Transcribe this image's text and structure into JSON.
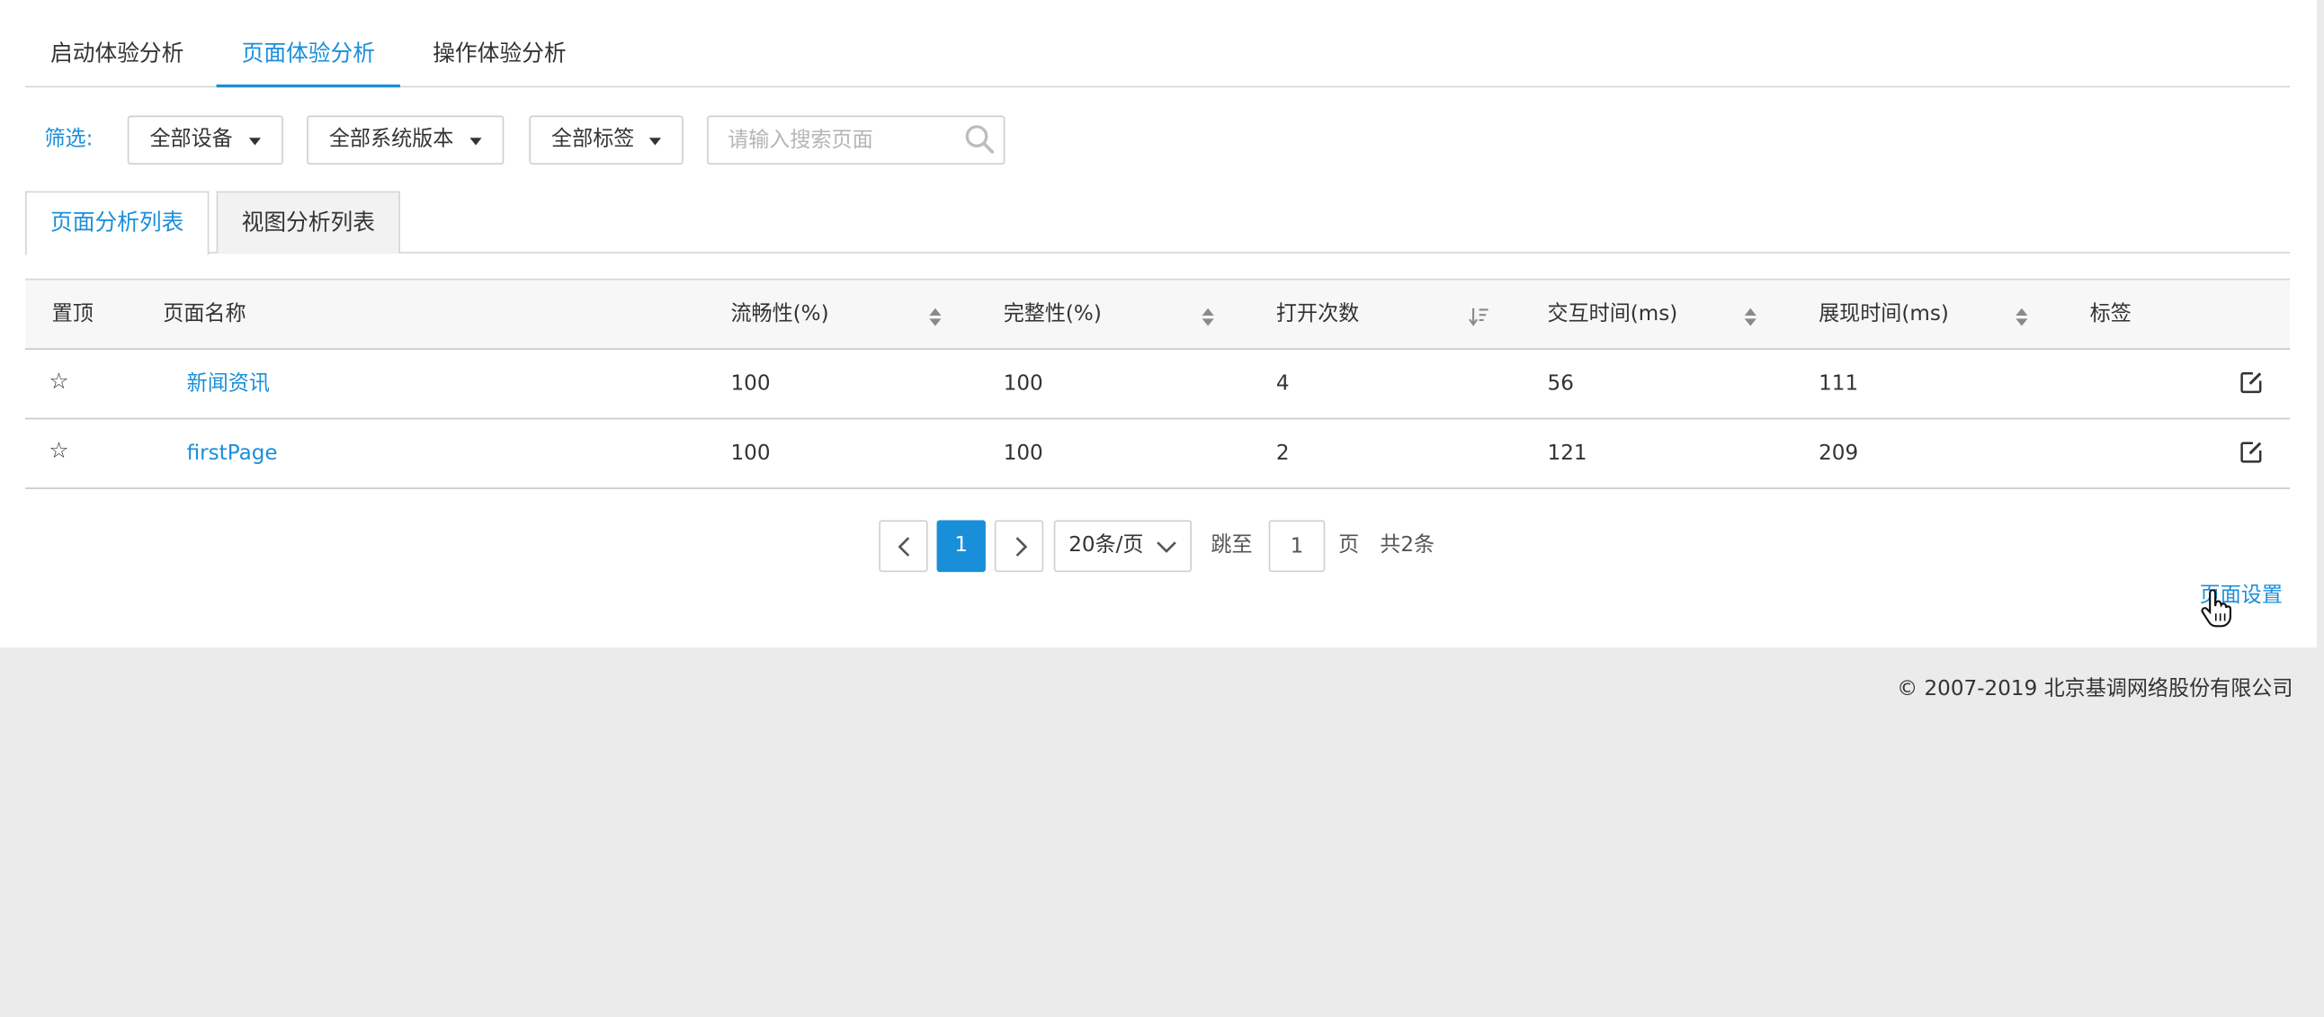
{
  "top_tabs": [
    {
      "label": "启动体验分析",
      "active": false
    },
    {
      "label": "页面体验分析",
      "active": true
    },
    {
      "label": "操作体验分析",
      "active": false
    }
  ],
  "filter": {
    "label": "筛选:",
    "device": "全部设备",
    "os_version": "全部系统版本",
    "tag": "全部标签",
    "search_placeholder": "请输入搜索页面"
  },
  "sub_tabs": [
    {
      "label": "页面分析列表",
      "active": true
    },
    {
      "label": "视图分析列表",
      "active": false
    }
  ],
  "table": {
    "columns": [
      "置顶",
      "页面名称",
      "流畅性(%)",
      "完整性(%)",
      "打开次数",
      "交互时间(ms)",
      "展现时间(ms)",
      "标签"
    ],
    "rows": [
      {
        "pin": "☆",
        "name": "新闻资讯",
        "smoothness": "100",
        "integrity": "100",
        "opens": "4",
        "interaction": "56",
        "display": "111",
        "tag": ""
      },
      {
        "pin": "☆",
        "name": "firstPage",
        "smoothness": "100",
        "integrity": "100",
        "opens": "2",
        "interaction": "121",
        "display": "209",
        "tag": ""
      }
    ]
  },
  "pagination": {
    "current_page": "1",
    "page_size": "20条/页",
    "jump_label": "跳至",
    "jump_value": "1",
    "page_unit": "页",
    "total": "共2条"
  },
  "page_setting": "页面设置",
  "footer": "© 2007-2019  北京基调网络股份有限公司",
  "colors": {
    "accent": "#1a8fd9",
    "background": "#ebebec",
    "panel": "#ffffff"
  }
}
